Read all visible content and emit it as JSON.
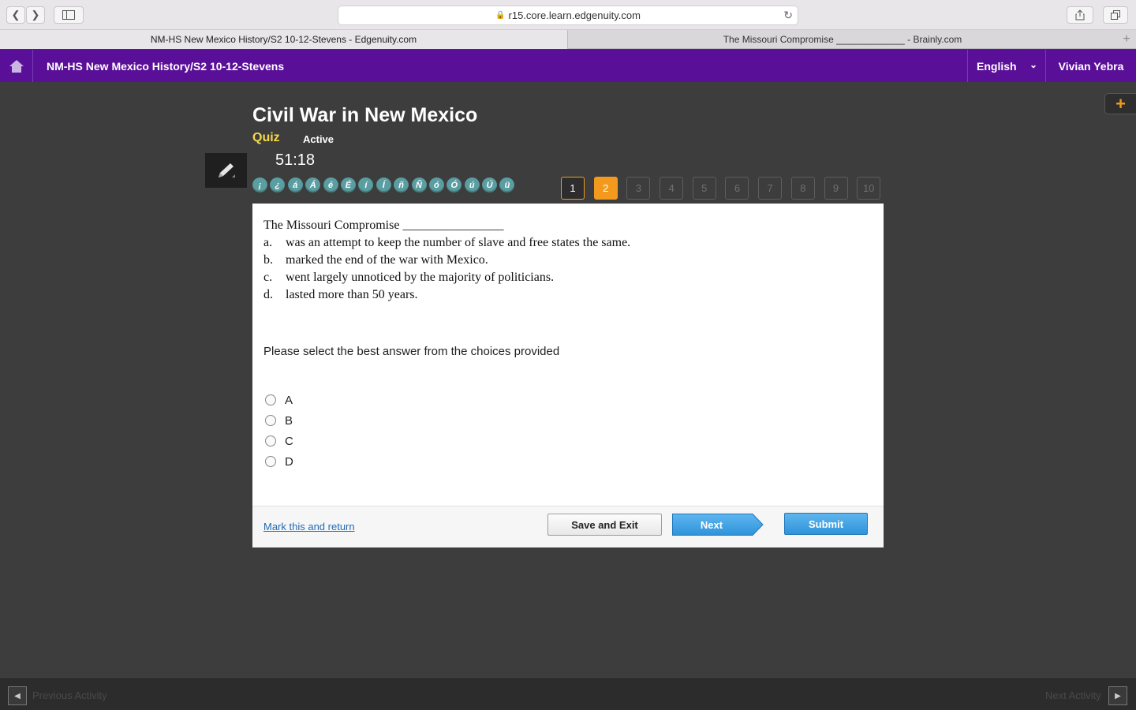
{
  "browser": {
    "url": "r15.core.learn.edgenuity.com",
    "tabs": [
      {
        "label": "NM-HS New Mexico History/S2 10-12-Stevens - Edgenuity.com"
      },
      {
        "label": "The Missouri Compromise _____________ - Brainly.com"
      }
    ]
  },
  "appbar": {
    "course": "NM-HS New Mexico History/S2 10-12-Stevens",
    "language": "English",
    "user": "Vivian Yebra"
  },
  "header": {
    "title": "Civil War in New Mexico",
    "type": "Quiz",
    "status": "Active",
    "timer": "51:18"
  },
  "special_chars": [
    "¡",
    "¿",
    "á",
    "Á",
    "é",
    "É",
    "í",
    "Í",
    "ñ",
    "Ñ",
    "ó",
    "Ó",
    "ú",
    "Ú",
    "ü"
  ],
  "question_nav": [
    {
      "label": "1",
      "state": "visited"
    },
    {
      "label": "2",
      "state": "current"
    },
    {
      "label": "3",
      "state": "unvisited"
    },
    {
      "label": "4",
      "state": "unvisited"
    },
    {
      "label": "5",
      "state": "unvisited"
    },
    {
      "label": "6",
      "state": "unvisited"
    },
    {
      "label": "7",
      "state": "unvisited"
    },
    {
      "label": "8",
      "state": "unvisited"
    },
    {
      "label": "9",
      "state": "unvisited"
    },
    {
      "label": "10",
      "state": "unvisited"
    }
  ],
  "question": {
    "stem": "The Missouri Compromise ________________",
    "options": [
      {
        "letter": "a.",
        "text": "was an attempt to keep the number of slave and free states the same."
      },
      {
        "letter": "b.",
        "text": "marked the end of the war with Mexico."
      },
      {
        "letter": "c.",
        "text": "went largely unnoticed by the majority of politicians."
      },
      {
        "letter": "d.",
        "text": "lasted more than 50 years."
      }
    ],
    "instruction": "Please select the best answer from the choices provided",
    "choices": [
      "A",
      "B",
      "C",
      "D"
    ]
  },
  "footer": {
    "mark_link": "Mark this and return",
    "save_label": "Save and Exit",
    "next_label": "Next",
    "submit_label": "Submit"
  },
  "bottombar": {
    "prev_label": "Previous Activity",
    "next_label": "Next Activity"
  },
  "colors": {
    "appbar": "#5a0f99",
    "accent_orange": "#f39a1e",
    "quiz_yellow": "#f5d94a",
    "button_blue": "#2f93da"
  }
}
